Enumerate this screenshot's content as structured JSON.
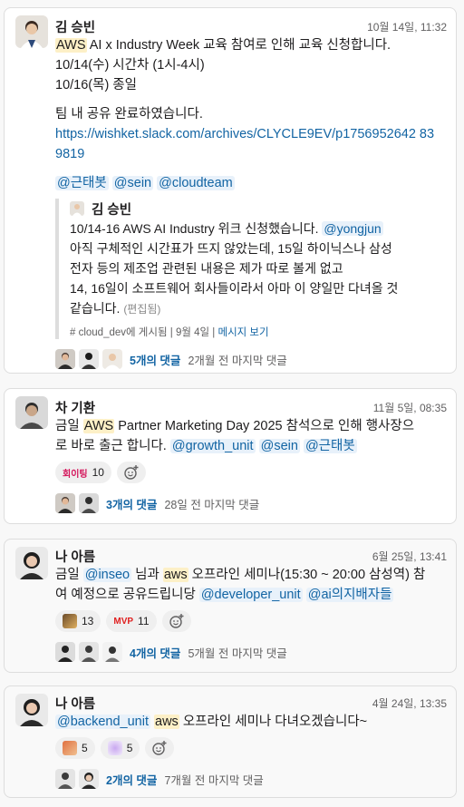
{
  "colors": {
    "link": "#1264a3",
    "highlight": "#fdf0c7",
    "mention_bg": "#e8f1fa"
  },
  "posts": [
    {
      "author": "김 승빈",
      "time": "10월 14일, 11:32",
      "line1_hl": "AWS",
      "line1_rest": " AI x Industry Week 교육 참여로 인해 교육 신청합니다.",
      "line2": "10/14(수) 시간차 (1시-4시)",
      "line3": "10/16(목) 종일",
      "line4": "팀 내 공유 완료하였습니다.",
      "link": "https://wishket.slack.com/archives/CLYCLE9EV/p1756952642 839819",
      "mentions": [
        "@근태봇",
        "@sein",
        "@cloudteam"
      ],
      "quote": {
        "author": "김 승빈",
        "l1_text": "10/14-16 AWS AI Industry 위크 신청했습니다. ",
        "l1_mention": "@yongjun",
        "l2": "아직 구체적인 시간표가 뜨지 않았는데, 15일 하이닉스나 삼성",
        "l3": "전자 등의 제조업 관련된 내용은 제가 따로 볼게 없고",
        "l4": "14, 16일이 소프트웨어 회사들이라서 아마 이 양일만 다녀올 것",
        "l5": "같습니다.",
        "edited": "(편집됨)",
        "channel": "# cloud_dev에 게시됨",
        "date": "9월 4일",
        "view": "메시지 보기"
      },
      "replies": "5개의 댓글",
      "last_reply": "2개월 전 마지막 댓글"
    },
    {
      "author": "차 기환",
      "time": "11월 5일, 08:35",
      "l1_pre": "금일 ",
      "l1_hl": "AWS",
      "l1_post": " Partner Marketing Day 2025 참석으로 인해 행사장으",
      "l2_pre": "로 바로 출근 합니다. ",
      "mentions": [
        "@growth_unit",
        "@sein",
        "@근태봇"
      ],
      "reaction_label": "회이팅",
      "reaction_count": "10",
      "replies": "3개의 댓글",
      "last_reply": "28일 전 마지막 댓글"
    },
    {
      "author": "나 아름",
      "time": "6월 25일, 13:41",
      "l1_pre": "금일 ",
      "l1_mention": "@inseo",
      "l1_mid": " 님과 ",
      "l1_hl": "aws",
      "l1_post": " 오프라인 세미나(15:30 ~ 20:00 삼성역) 참",
      "l2_pre": "여 예정으로 공유드립니당 ",
      "mentions": [
        "@developer_unit",
        "@ai의지배자들"
      ],
      "r1_count": "13",
      "r2_label": "MVP",
      "r2_count": "11",
      "replies": "4개의 댓글",
      "last_reply": "5개월 전 마지막 댓글"
    },
    {
      "author": "나 아름",
      "time": "4월 24일, 13:35",
      "mention": "@backend_unit",
      "hl": "aws",
      "rest": " 오프라인 세미나 다녀오겠습니다~",
      "r1_count": "5",
      "r2_count": "5",
      "replies": "2개의 댓글",
      "last_reply": "7개월 전 마지막 댓글"
    }
  ]
}
